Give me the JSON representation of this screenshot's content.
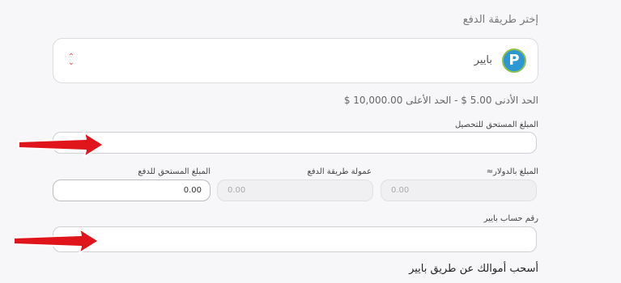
{
  "payment": {
    "section_title": "إختر طريقة الدفع",
    "method_name": "بايير",
    "logo_letter": "P",
    "limits_text": "الحد الأدنى 5.00 $   -   الحد الأعلى 10,000.00 $"
  },
  "amount_field": {
    "label": "المبلغ المستحق للتحصيل",
    "value": ""
  },
  "summary": {
    "usd_label": "المبلغ بالدولار≈",
    "usd_value": "0.00",
    "fee_label": "عمولة طريقة الدفع",
    "fee_value": "0.00",
    "due_label": "المبلغ المستحق للدفع",
    "due_value": "0.00"
  },
  "account_field": {
    "label": "رقم حساب بايير",
    "value": ""
  },
  "footer": {
    "text": "أسحب أموالك عن طريق بايير"
  },
  "colors": {
    "arrow": "#e0141b",
    "logo_bg": "#2d97d4",
    "logo_ring": "#8bc34a"
  }
}
